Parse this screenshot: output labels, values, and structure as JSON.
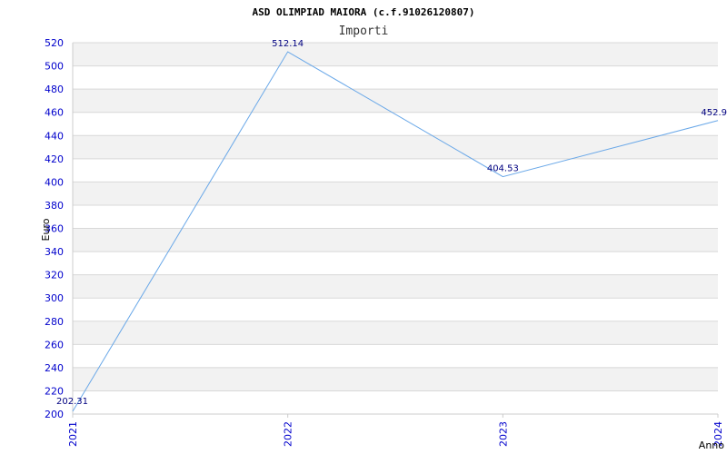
{
  "chart_data": {
    "type": "line",
    "title": "ASD OLIMPIAD MAIORA (c.f.91026120807)",
    "subtitle": "Importi",
    "xlabel": "Anno",
    "ylabel": "Euro",
    "categories": [
      "2021",
      "2022",
      "2023",
      "2024"
    ],
    "series": [
      {
        "values": [
          202.31,
          512.14,
          404.53,
          452.9
        ]
      }
    ],
    "data_labels": [
      "202.31",
      "512.14",
      "404.53",
      "452.9"
    ],
    "ylim": [
      200,
      520
    ],
    "y_ticks": [
      "200",
      "220",
      "240",
      "260",
      "280",
      "300",
      "320",
      "340",
      "360",
      "380",
      "400",
      "420",
      "440",
      "460",
      "480",
      "500",
      "520"
    ],
    "grid": true,
    "colors": {
      "line": "#6aa8e8",
      "band": "#f2f2f2",
      "grid": "#d8d8d8",
      "axis": "#cccccc",
      "tick_text": "#0000cc"
    }
  }
}
